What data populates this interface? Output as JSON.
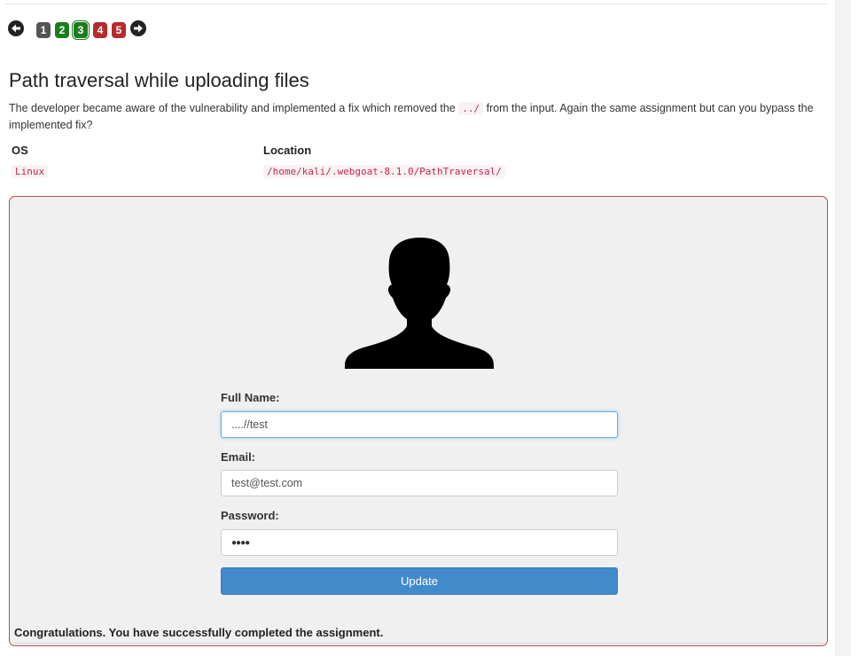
{
  "pager": {
    "pages": [
      {
        "label": "1",
        "color": "#555555"
      },
      {
        "label": "2",
        "color": "#1e7b1e"
      },
      {
        "label": "3",
        "color": "#1e7b1e",
        "current": true
      },
      {
        "label": "4",
        "color": "#b52a2a"
      },
      {
        "label": "5",
        "color": "#b52a2a"
      }
    ],
    "prev_icon": "arrow-left-circle",
    "next_icon": "arrow-right-circle"
  },
  "lesson": {
    "title": "Path traversal while uploading files",
    "description_before": "The developer became aware of the vulnerability and implemented a fix which removed the ",
    "description_code": "../",
    "description_after": " from the input. Again the same assignment but can you bypass the implemented fix?",
    "os_header": "OS",
    "location_header": "Location",
    "os_value": "Linux",
    "location_value": "/home/kali/.webgoat-8.1.0/PathTraversal/"
  },
  "form": {
    "avatar_icon": "user-silhouette",
    "full_name_label": "Full Name:",
    "full_name_value": "....//test",
    "email_label": "Email:",
    "email_value": "test@test.com",
    "password_label": "Password:",
    "password_value": "●●●●",
    "update_label": "Update"
  },
  "feedback": "Congratulations. You have successfully completed the assignment.",
  "colors": {
    "accent": "#428bca",
    "panel_border": "#b94a48",
    "code_text": "#c7254e"
  }
}
